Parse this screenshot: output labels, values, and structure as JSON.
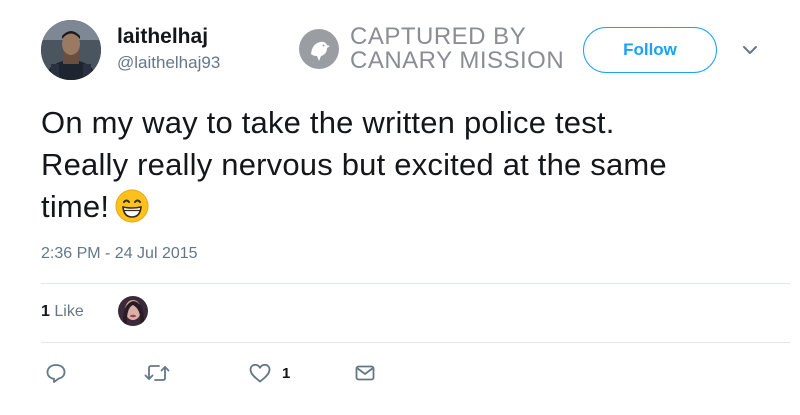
{
  "author": {
    "display_name": "laithelhaj",
    "handle": "@laithelhaj93"
  },
  "watermark": {
    "line1": "CAPTURED BY",
    "line2": "CANARY MISSION"
  },
  "follow_label": "Follow",
  "tweet": {
    "text_line1": "On my way to take the written police test.",
    "text_line2": "Really really nervous but excited at the same",
    "text_line3": "time!",
    "emoji": "grinning-face-with-smiling-eyes",
    "timestamp": "2:36 PM - 24 Jul 2015"
  },
  "stats": {
    "likes_number": "1",
    "likes_word": "Like"
  },
  "actions": {
    "reply_icon": "reply-icon",
    "retweet_icon": "retweet-icon",
    "like_icon": "heart-icon",
    "like_count": "1",
    "dm_icon": "envelope-icon"
  },
  "colors": {
    "accent": "#1da1f2",
    "secondary_text": "#657786",
    "primary_text": "#14171a",
    "watermark": "#8a8e92"
  }
}
